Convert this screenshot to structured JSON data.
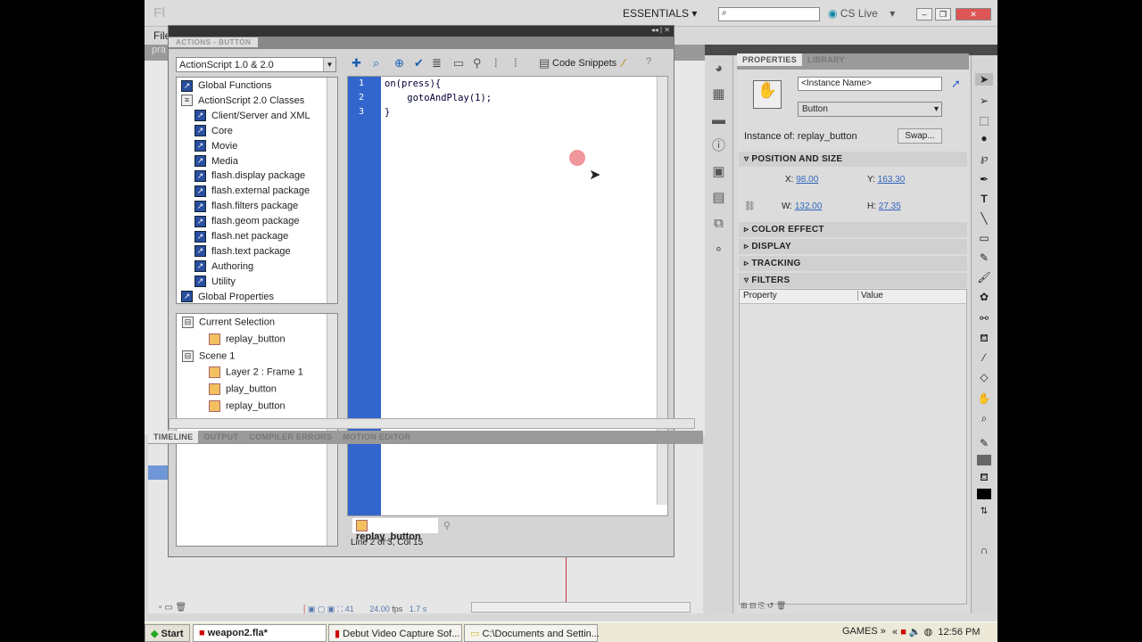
{
  "app": {
    "logo": "Fl",
    "workspace": "ESSENTIALS",
    "search_placeholder": "",
    "cslive": "CS Live",
    "menu_file": "File",
    "doc_tab": "pra"
  },
  "actions": {
    "title": "ACTIONS - BUTTON",
    "language": "ActionScript 1.0 & 2.0",
    "tree": [
      "Global Functions",
      "ActionScript 2.0 Classes",
      "Client/Server and XML",
      "Core",
      "Movie",
      "Media",
      "flash.display package",
      "flash.external package",
      "flash.filters package",
      "flash.geom package",
      "flash.net package",
      "flash.text package",
      "Authoring",
      "Utility",
      "Global Properties"
    ],
    "nav": [
      {
        "label": "Current Selection",
        "level": 0
      },
      {
        "label": "replay_button",
        "level": 1
      },
      {
        "label": "Scene 1",
        "level": 0
      },
      {
        "label": "Layer 2 : Frame 1",
        "level": 1
      },
      {
        "label": "play_button",
        "level": 1
      },
      {
        "label": "replay_button",
        "level": 1
      }
    ],
    "code_snippets": "Code Snippets",
    "lines": [
      "1",
      "2",
      "3"
    ],
    "code": [
      "on(press){",
      "    gotoAndPlay(1);",
      "}"
    ],
    "script_tab": "replay_button",
    "status": "Line 2 of 3, Col 15"
  },
  "timeline": {
    "tabs": [
      "TIMELINE",
      "OUTPUT",
      "COMPILER ERRORS",
      "MOTION EDITOR"
    ],
    "frame": "41",
    "fps": "24.00",
    "fps_unit": "fps",
    "time": "1.7 s"
  },
  "properties": {
    "tabs": [
      "PROPERTIES",
      "LIBRARY"
    ],
    "instance_name_placeholder": "<Instance Name>",
    "type": "Button",
    "instance_of": "Instance of: replay_button",
    "swap": "Swap...",
    "position_size": "POSITION AND SIZE",
    "x_label": "X:",
    "x": "98.00",
    "y_label": "Y:",
    "y": "163.30",
    "w_label": "W:",
    "w": "132.00",
    "h_label": "H:",
    "h": "27.35",
    "sections": [
      "COLOR EFFECT",
      "DISPLAY",
      "TRACKING"
    ],
    "filters": "FILTERS",
    "col_property": "Property",
    "col_value": "Value"
  },
  "taskbar": {
    "start": "Start",
    "items": [
      "weapon2.fla*",
      "Debut Video Capture Sof...",
      "C:\\Documents and Settin..."
    ],
    "games": "GAMES",
    "clock": "12:56 PM"
  }
}
